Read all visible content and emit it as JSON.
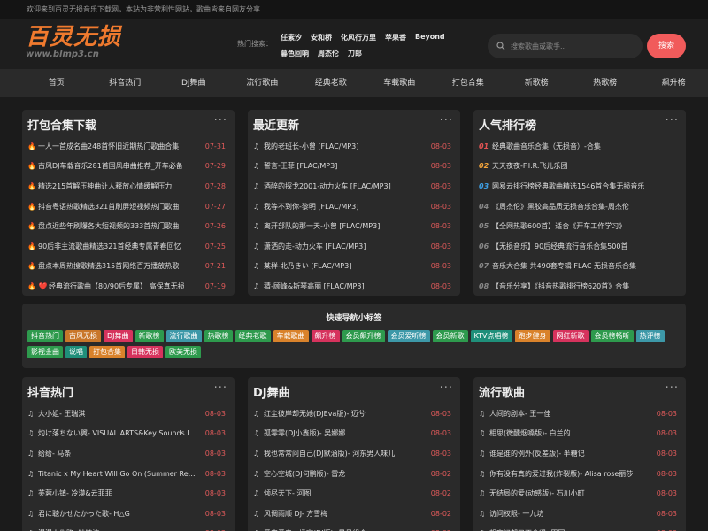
{
  "topbar": {
    "notice": "欢迎来到百灵无损音乐下载网，本站为非营利性网站，歌曲皆来自网友分享"
  },
  "logo": {
    "name": "百灵无损",
    "url": "www.blmp3.cn"
  },
  "hot": {
    "label": "热门搜索：",
    "row1": [
      "任素汐",
      "安和桥",
      "化风行万里",
      "苹果香",
      "Beyond"
    ],
    "row2": [
      "暮色回响",
      "周杰伦",
      "刀郎"
    ]
  },
  "search": {
    "placeholder": "搜索歌曲或歌手...",
    "button": "搜索"
  },
  "nav": [
    "首页",
    "抖音热门",
    "DJ舞曲",
    "流行歌曲",
    "经典老歌",
    "车载歌曲",
    "打包合集",
    "新歌榜",
    "热歌榜",
    "飙升榜"
  ],
  "colors": {
    "accent": "#f15b5b",
    "date": "#e05a5a",
    "logo": "#f07a2e"
  },
  "panels": {
    "packs": {
      "title": "打包合集下载",
      "more": "···",
      "items": [
        {
          "icon": "🔥",
          "text": "一人一首成名曲248首怀旧近期热门歌曲合集",
          "date": "07-31"
        },
        {
          "icon": "🔥",
          "text": "古风DJ车载音乐281首国风串曲推荐_开车必备",
          "date": "07-29"
        },
        {
          "icon": "🔥",
          "text": "精选215首解压神曲让人释放心情缓解压力",
          "date": "07-28"
        },
        {
          "icon": "🔥",
          "text": "抖音粤语热歌精选321首刷屏短视频热门歌曲",
          "date": "07-27"
        },
        {
          "icon": "🔥",
          "text": "盘点近些年刷爆各大短视频的333首热门歌曲",
          "date": "07-26"
        },
        {
          "icon": "🔥",
          "text": "90后非主流歌曲精选321首经典专属青春回忆",
          "date": "07-25"
        },
        {
          "icon": "🔥",
          "text": "盘点本周热搜歌精选315首网络百万播放热歌",
          "date": "07-21"
        },
        {
          "icon": "🔥 ❤️",
          "text": "经典流行歌曲【80/90后专属】 高保真无损",
          "date": "07-19"
        }
      ]
    },
    "latest": {
      "title": "最近更新",
      "more": "···",
      "items": [
        {
          "icon": "♫",
          "text": "我的老班长-小曾 [FLAC/MP3]",
          "date": "08-03"
        },
        {
          "icon": "♫",
          "text": "誓言-王菲 [FLAC/MP3]",
          "date": "08-03"
        },
        {
          "icon": "♫",
          "text": "酒醉的探戈2001-动力火车 [FLAC/MP3]",
          "date": "08-03"
        },
        {
          "icon": "♫",
          "text": "我等不到你-黎明 [FLAC/MP3]",
          "date": "08-03"
        },
        {
          "icon": "♫",
          "text": "离开部队的那一天-小曾 [FLAC/MP3]",
          "date": "08-03"
        },
        {
          "icon": "♫",
          "text": "潇洒的走-动力火车 [FLAC/MP3]",
          "date": "08-03"
        },
        {
          "icon": "♫",
          "text": "某样-北乃きい [FLAC/MP3]",
          "date": "08-03"
        },
        {
          "icon": "♫",
          "text": "猜-顾峰&斯琴高丽 [FLAC/MP3]",
          "date": "08-03"
        }
      ]
    },
    "ranking": {
      "title": "人气排行榜",
      "more": "···",
      "items": [
        {
          "rank": "01",
          "text": "经典歌曲音乐合集（无损音）-合集"
        },
        {
          "rank": "02",
          "text": "天天夜夜-F.I.R.飞儿乐团"
        },
        {
          "rank": "03",
          "text": "网易云排行榜经典歌曲精选1546首合集无损音乐"
        },
        {
          "rank": "04",
          "text": "《周杰伦》黑胶高品质无损音乐合集-周杰伦"
        },
        {
          "rank": "05",
          "text": "【全网热歌600首】适合《开车工作学习》"
        },
        {
          "rank": "06",
          "text": "【无损音乐】90后经典流行音乐合集500首"
        },
        {
          "rank": "07",
          "text": "音乐大合集 共490套专辑 FLAC 无损音乐合集"
        },
        {
          "rank": "08",
          "text": "【音乐分享】《抖音热歌排行榜620首》合集"
        }
      ]
    },
    "douyin": {
      "title": "抖音热门",
      "more": "···",
      "items": [
        {
          "icon": "♫",
          "text": "大小姐- 王瑞淇",
          "date": "08-03"
        },
        {
          "icon": "♫",
          "text": "灼け落ちない翼- VISUAL ARTS&Key Sounds Label",
          "date": "08-03"
        },
        {
          "icon": "♫",
          "text": "给给- 马条",
          "date": "08-03"
        },
        {
          "icon": "♫",
          "text": "Titanic x My Heart Will Go On (Summer Remix)",
          "date": "08-03"
        },
        {
          "icon": "♫",
          "text": "芙蓉小镇- 冷漠&云菲菲",
          "date": "08-03"
        },
        {
          "icon": "♫",
          "text": "君に聴かせたかった歌- H△G",
          "date": "08-03"
        },
        {
          "icon": "♫",
          "text": "漫漫人生路- 钟镇涛",
          "date": "08-03"
        }
      ]
    },
    "dj": {
      "title": "DJ舞曲",
      "more": "···",
      "items": [
        {
          "icon": "♫",
          "text": "红尘彼岸却无她(DJEva版)- 迈兮",
          "date": "08-03"
        },
        {
          "icon": "♫",
          "text": "孤零零(DJ小鑫版)- 吴娜娜",
          "date": "08-03"
        },
        {
          "icon": "♫",
          "text": "我也常常问自己(DJ默涵版)- 河东男人味儿",
          "date": "08-03"
        },
        {
          "icon": "♫",
          "text": "空心空城(DJ何鹏版)- 雷龙",
          "date": "08-02"
        },
        {
          "icon": "♫",
          "text": "倾尽天下- 河图",
          "date": "08-02"
        },
        {
          "icon": "♫",
          "text": "风调雨顺 DJ- 方雪梅",
          "date": "08-02"
        },
        {
          "icon": "♫",
          "text": "爱来爱去一场空(DJ版)- 星月组合",
          "date": "08-02"
        }
      ]
    },
    "pop": {
      "title": "流行歌曲",
      "more": "···",
      "items": [
        {
          "icon": "♫",
          "text": "人间的剧本- 王一佳",
          "date": "08-03"
        },
        {
          "icon": "♫",
          "text": "相思(微醺烟嗓版)- 白兰的",
          "date": "08-03"
        },
        {
          "icon": "♫",
          "text": "谁是谁的例外(反差版)- 半糖记",
          "date": "08-03"
        },
        {
          "icon": "♫",
          "text": "你有没有真的爱过我(炸裂版)- Alisa rose丽莎",
          "date": "08-03"
        },
        {
          "icon": "♫",
          "text": "无结局的爱(动感版)- 石川小町",
          "date": "08-03"
        },
        {
          "icon": "♫",
          "text": "访问权限- 一九坊",
          "date": "08-03"
        },
        {
          "icon": "♫",
          "text": "想忘记却又不舍得- 田园",
          "date": "08-03"
        }
      ]
    }
  },
  "tags": {
    "title": "快速导航小标签",
    "items": [
      {
        "label": "抖音热门",
        "color": "#2e9a4d"
      },
      {
        "label": "古风无损",
        "color": "#c9772a"
      },
      {
        "label": "DJ舞曲",
        "color": "#d6335d"
      },
      {
        "label": "新歌榜",
        "color": "#2e9a4d"
      },
      {
        "label": "流行歌曲",
        "color": "#3d98a8"
      },
      {
        "label": "热歌榜",
        "color": "#2e9a4d"
      },
      {
        "label": "经典老歌",
        "color": "#2e9a4d"
      },
      {
        "label": "车载歌曲",
        "color": "#d9822b"
      },
      {
        "label": "飙升榜",
        "color": "#d6335d"
      },
      {
        "label": "会员飙升榜",
        "color": "#2e9a4d"
      },
      {
        "label": "会员爱听榜",
        "color": "#3d98a8"
      },
      {
        "label": "会员新歌",
        "color": "#2e9a4d"
      },
      {
        "label": "KTV点唱榜",
        "color": "#1f8f7a"
      },
      {
        "label": "跑步健身",
        "color": "#d9822b"
      },
      {
        "label": "网红新歌",
        "color": "#d6335d"
      },
      {
        "label": "会员榜畅听",
        "color": "#2e9a4d"
      },
      {
        "label": "热评榜",
        "color": "#3d98a8"
      },
      {
        "label": "影视金曲",
        "color": "#2e9a4d"
      },
      {
        "label": "说唱",
        "color": "#1f8f7a"
      },
      {
        "label": "打包合集",
        "color": "#d9822b"
      },
      {
        "label": "日韩无损",
        "color": "#d6335d"
      },
      {
        "label": "欧美无损",
        "color": "#2e9a4d"
      }
    ]
  }
}
